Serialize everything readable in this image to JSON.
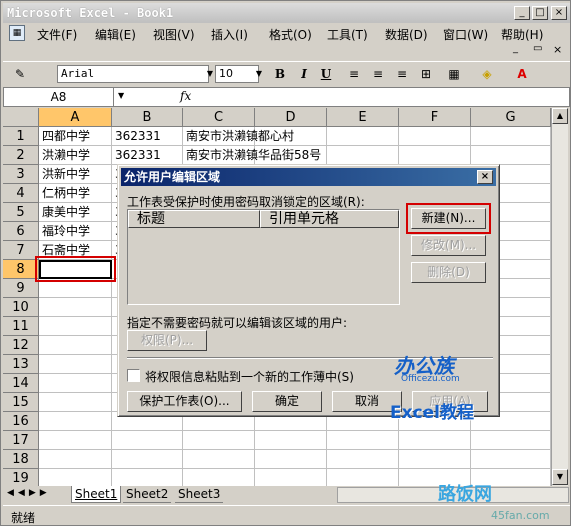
{
  "app": {
    "title": "Microsoft Excel - Book1",
    "min": "_",
    "max": "□",
    "close": "×",
    "doc_min": "_",
    "doc_restore": "▭",
    "doc_close": "×"
  },
  "menu": [
    "文件(F)",
    "编辑(E)",
    "视图(V)",
    "插入(I)",
    "格式(O)",
    "工具(T)",
    "数据(D)",
    "窗口(W)",
    "帮助(H)"
  ],
  "toolbar": {
    "font": "Arial",
    "size": "10",
    "bold": "B",
    "italic": "I",
    "underline": "U"
  },
  "namebox": "A8",
  "fx": "fx",
  "columns": [
    "A",
    "B",
    "C",
    "D",
    "E",
    "F",
    "G"
  ],
  "rows": [
    "1",
    "2",
    "3",
    "4",
    "5",
    "6",
    "7",
    "8",
    "9",
    "10",
    "11",
    "12",
    "13",
    "14",
    "15",
    "16",
    "17",
    "18",
    "19"
  ],
  "data": [
    [
      "四都中学",
      "362331",
      "南安市洪濑镇都心村"
    ],
    [
      "洪濑中学",
      "362331",
      "南安市洪濑镇华品街58号"
    ],
    [
      "洪新中学",
      "3",
      ""
    ],
    [
      "仁柄中学",
      "3",
      ""
    ],
    [
      "康美中学",
      "3",
      ""
    ],
    [
      "福玲中学",
      "3",
      ""
    ],
    [
      "石斋中学",
      "3",
      ""
    ]
  ],
  "sheets": [
    "Sheet1",
    "Sheet2",
    "Sheet3"
  ],
  "status": "就绪",
  "dialog": {
    "title": "允许用户编辑区域",
    "ranges_label": "工作表受保护时使用密码取消锁定的区域(R):",
    "col_title": "标题",
    "col_ref": "引用单元格",
    "new_btn": "新建(N)...",
    "modify_btn": "修改(M)...",
    "delete_btn": "删除(D)",
    "users_label": "指定不需要密码就可以编辑该区域的用户:",
    "perm_btn": "权限(P)...",
    "paste_label": "将权限信息粘贴到一个新的工作薄中(S)",
    "protect_btn": "保护工作表(O)...",
    "ok_btn": "确定",
    "cancel_btn": "取消",
    "apply_btn": "应用(A)"
  },
  "watermarks": {
    "logo1": "办公族",
    "logo1_sub": "Officezu.com",
    "logo2": "Excel教程",
    "logo3": "路饭网",
    "logo3_sub": "45fan.com"
  }
}
